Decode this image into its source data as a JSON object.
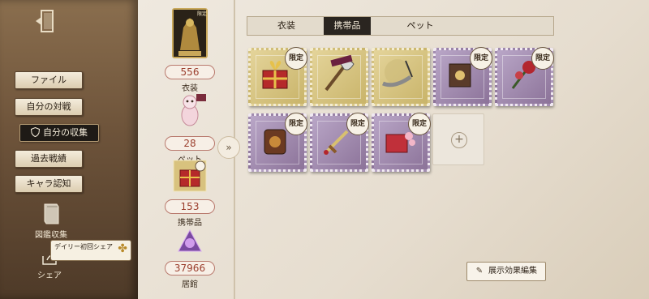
{
  "sidebar": {
    "nav": [
      "ファイル",
      "自分の対戦",
      "自分の収集",
      "過去戦績",
      "キャラ認知"
    ],
    "active_index": 2,
    "illustrated_collection_label": "図鑑収集",
    "share_label": "シェア",
    "daily_share_badge": "デイリー初回シェア"
  },
  "categories": [
    {
      "count": "556",
      "label": "衣装"
    },
    {
      "count": "28",
      "label": "ペット"
    },
    {
      "count": "153",
      "label": "携帯品"
    },
    {
      "count": "37966",
      "label": "居館"
    }
  ],
  "tabs": [
    "衣装",
    "携帯品",
    "ペット"
  ],
  "active_tab": 1,
  "items": [
    {
      "frame": "gold",
      "limited": "限定",
      "icon": "gift-box-icon"
    },
    {
      "frame": "gold",
      "limited": "",
      "icon": "axe-icon"
    },
    {
      "frame": "gold",
      "limited": "",
      "icon": "chain-horn-icon"
    },
    {
      "frame": "purple",
      "limited": "限定",
      "icon": "book-icon"
    },
    {
      "frame": "purple",
      "limited": "限定",
      "icon": "rose-icon"
    },
    {
      "frame": "purple",
      "limited": "限定",
      "icon": "lantern-icon"
    },
    {
      "frame": "purple",
      "limited": "限定",
      "icon": "sword-icon"
    },
    {
      "frame": "purple",
      "limited": "限定",
      "icon": "gift-box-icon"
    }
  ],
  "edit_button_label": "展示効果編集",
  "limited_top_card_label": "限定"
}
